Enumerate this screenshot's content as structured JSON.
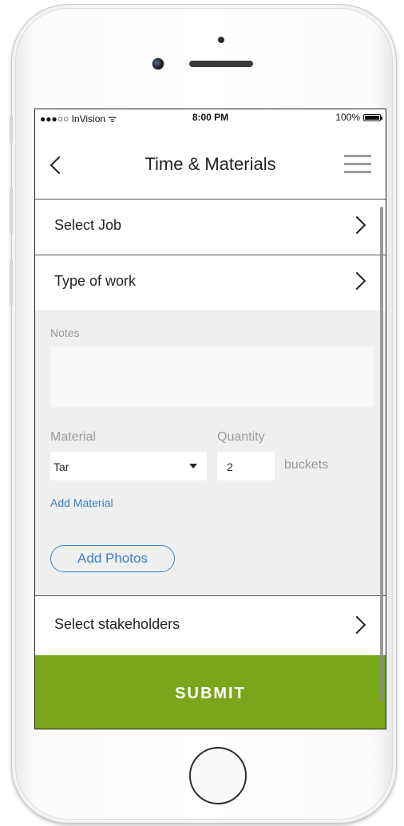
{
  "status_bar": {
    "carrier": "●●●○○ InVision ᯤ",
    "time": "8:00 PM",
    "battery": "100%"
  },
  "header": {
    "title": "Time & Materials"
  },
  "rows": {
    "select_job": "Select Job",
    "type_of_work": "Type of work",
    "select_stakeholders": "Select stakeholders"
  },
  "form": {
    "notes_label": "Notes",
    "notes_value": "",
    "material_label": "Material",
    "material_value": "Tar",
    "quantity_label": "Quantity",
    "quantity_value": "2",
    "unit": "buckets",
    "add_material": "Add Material",
    "add_photos": "Add Photos"
  },
  "submit_label": "SUBMIT",
  "colors": {
    "accent_green": "#7aa61b",
    "link_blue": "#3a7fc9",
    "form_background": "#efefef"
  },
  "icons": [
    "back-arrow-icon",
    "hamburger-menu-icon",
    "chevron-right-icon",
    "dropdown-caret-icon",
    "battery-icon",
    "wifi-icon"
  ]
}
